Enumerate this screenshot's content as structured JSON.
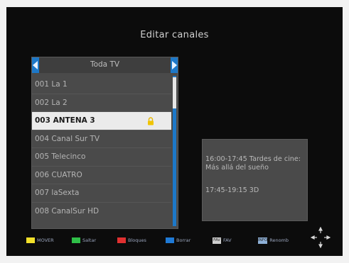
{
  "screen": {
    "title": "Editar canales"
  },
  "category": {
    "label": "Toda TV"
  },
  "channels": [
    {
      "label": "001 La 1",
      "locked": false
    },
    {
      "label": "002 La 2",
      "locked": false
    },
    {
      "label": "003 ANTENA 3",
      "locked": true,
      "selected": true
    },
    {
      "label": "004 Canal Sur TV",
      "locked": false
    },
    {
      "label": "005 Telecinco",
      "locked": false
    },
    {
      "label": "006 CUATRO",
      "locked": false
    },
    {
      "label": "007 laSexta",
      "locked": false
    },
    {
      "label": "008 CanalSur HD",
      "locked": false
    }
  ],
  "epg": {
    "event1": "16:00-17:45  Tardes de cine: Más allá del sueño",
    "event2": "17:45-19:15  3D"
  },
  "legend": {
    "move": "MOVER",
    "skip": "Saltar",
    "block": "Bloques",
    "delete": "Borrar",
    "fav_key": "FAV",
    "fav": "FAV",
    "rename_key": "INFO",
    "rename": "Renomb"
  },
  "colors": {
    "yellow": "#f2e02a",
    "green": "#2fbf48",
    "red": "#e03030",
    "blue": "#1f7ad6",
    "accent": "#1d78c8"
  }
}
